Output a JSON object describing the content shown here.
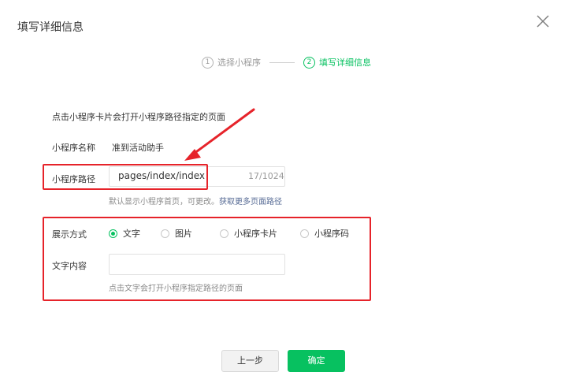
{
  "dialog": {
    "title": "填写详细信息"
  },
  "steps": [
    {
      "num": "1",
      "label": "选择小程序"
    },
    {
      "num": "2",
      "label": "填写详细信息"
    }
  ],
  "form": {
    "hint_top": "点击小程序卡片会打开小程序路径指定的页面",
    "name_label": "小程序名称",
    "name_value": "准到活动助手",
    "path_label": "小程序路径",
    "path_value": "pages/index/index",
    "path_count": "17/1024",
    "path_hint": "默认显示小程序首页，可更改。",
    "path_link": "获取更多页面路径",
    "display_label": "展示方式",
    "display_options": [
      "文字",
      "图片",
      "小程序卡片",
      "小程序码"
    ],
    "display_selected": "文字",
    "text_label": "文字内容",
    "text_value": "",
    "text_hint": "点击文字会打开小程序指定路径的页面"
  },
  "buttons": {
    "prev": "上一步",
    "ok": "确定"
  },
  "colors": {
    "accent": "#07c160",
    "annotation_red": "#e6232a",
    "link": "#576b95"
  }
}
